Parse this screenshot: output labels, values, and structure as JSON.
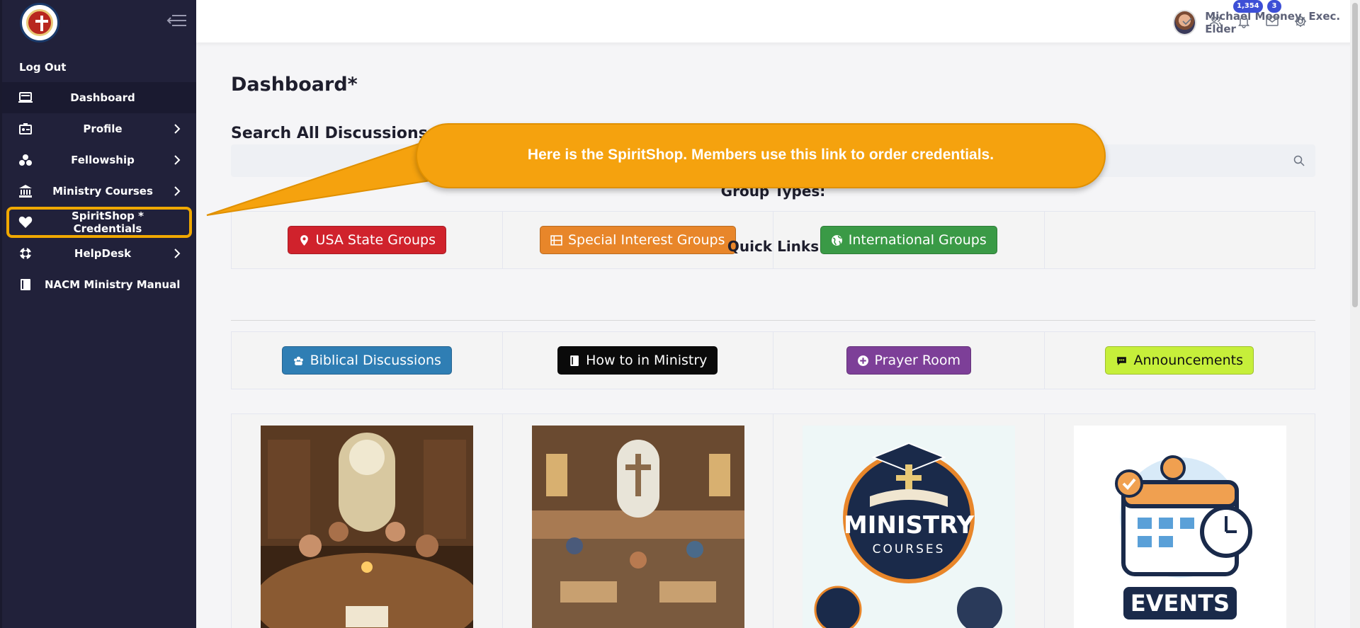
{
  "sidebar": {
    "logout_label": "Log Out",
    "items": [
      {
        "label": "Dashboard",
        "icon": "laptop-icon"
      },
      {
        "label": "Profile",
        "icon": "id-card-icon"
      },
      {
        "label": "Fellowship",
        "icon": "users-icon"
      },
      {
        "label": "Ministry Courses",
        "icon": "institution-icon"
      },
      {
        "label": "SpiritShop * Credentials",
        "icon": "heart-icon"
      },
      {
        "label": "HelpDesk",
        "icon": "life-ring-icon"
      },
      {
        "label": "NACM Ministry Manual",
        "icon": "book-icon"
      }
    ]
  },
  "header": {
    "user_name": "Michael Mooney, Exec. Elder",
    "notifications_count": "1,354",
    "messages_count": "3"
  },
  "main": {
    "title": "Dashboard*",
    "search_title": "Search All Discussions:",
    "search_placeholder": "",
    "group_types_title": "Group Types:",
    "groups": [
      {
        "label": "USA State Groups",
        "color": "#d0222c",
        "icon": "map-marker-icon"
      },
      {
        "label": "Special Interest Groups",
        "color": "#e8862a",
        "icon": "film-icon"
      },
      {
        "label": "International Groups",
        "color": "#3a9a46",
        "icon": "globe-icon"
      }
    ],
    "quick_links_title": "Quick Links",
    "quick_links": [
      {
        "label": "Biblical Discussions",
        "color": "#2f7eb4",
        "icon": "group-icon"
      },
      {
        "label": "How to in Ministry",
        "color": "#0a0a0a",
        "icon": "book-icon"
      },
      {
        "label": "Prayer Room",
        "color": "#7d3f98",
        "icon": "plus-circle-icon"
      },
      {
        "label": "Announcements",
        "color": "#c6ef3a",
        "icon": "comment-icon"
      }
    ],
    "tiles": [
      {
        "name": "bible-study-image"
      },
      {
        "name": "church-interior-image"
      },
      {
        "name": "ministry-courses-image",
        "text": "MINISTRY",
        "subtext": "COURSES"
      },
      {
        "name": "events-image",
        "text": "EVENTS"
      }
    ]
  },
  "callout": {
    "text": "Here is the SpiritShop.  Members use this link to order credentials."
  }
}
